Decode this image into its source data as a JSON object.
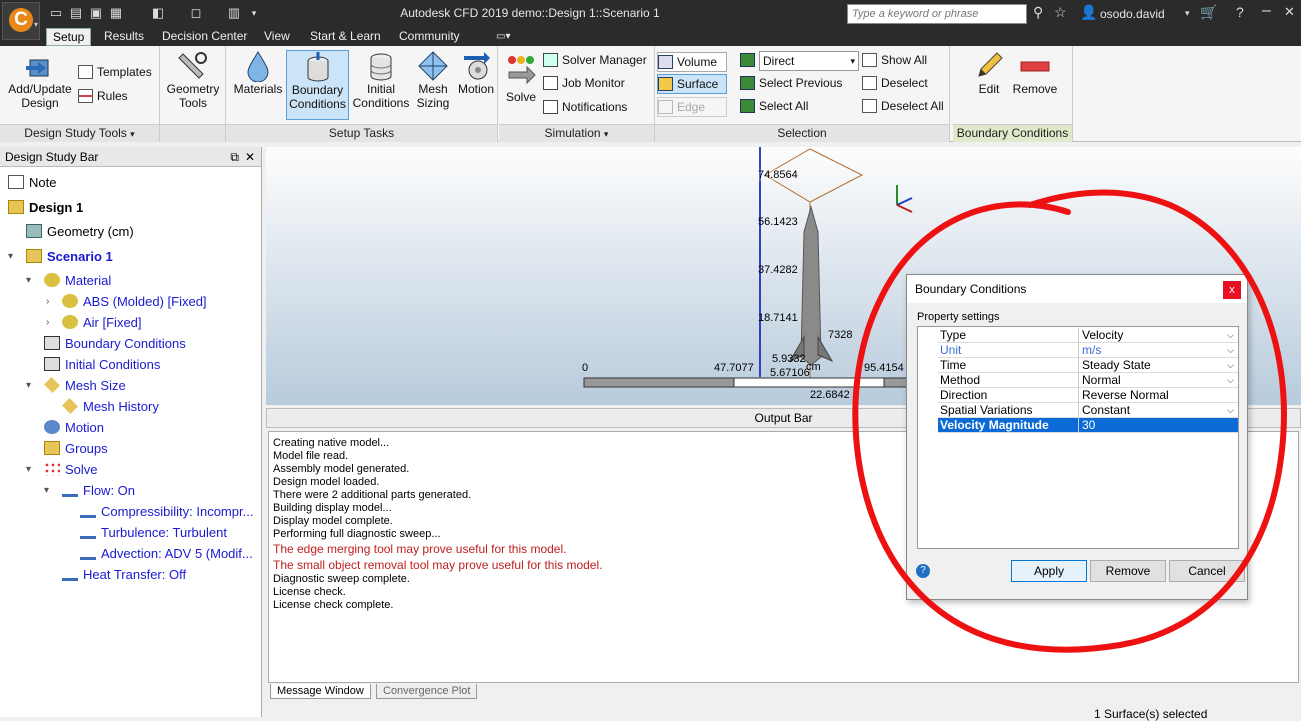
{
  "app": {
    "title": "Autodesk CFD 2019   demo::Design 1::Scenario 1",
    "search_placeholder": "Type a keyword or phrase",
    "username": "osodo.david",
    "logo_letter": "C"
  },
  "ribbon_tabs": [
    "Setup",
    "Results",
    "Decision Center",
    "View",
    "Start & Learn",
    "Community"
  ],
  "ribbon": {
    "design_study_tools": {
      "label": "Design Study Tools",
      "add_update_1": "Add/Update",
      "add_update_2": "Design",
      "templates": "Templates",
      "rules": "Rules"
    },
    "geometry_tools": {
      "line1": "Geometry",
      "line2": "Tools"
    },
    "setup_tasks": {
      "label": "Setup Tasks",
      "materials": "Materials",
      "bc_1": "Boundary",
      "bc_2": "Conditions",
      "ic_1": "Initial",
      "ic_2": "Conditions",
      "mesh_1": "Mesh",
      "mesh_2": "Sizing",
      "motion": "Motion"
    },
    "simulation": {
      "label": "Simulation",
      "solve": "Solve",
      "solver_manager": "Solver Manager",
      "job_monitor": "Job Monitor",
      "notifications": "Notifications"
    },
    "selection": {
      "label": "Selection",
      "volume": "Volume",
      "surface": "Surface",
      "edge": "Edge",
      "direct": "Direct",
      "select_previous": "Select Previous",
      "select_all": "Select All",
      "show_all": "Show All",
      "deselect": "Deselect",
      "deselect_all": "Deselect All"
    },
    "bc_context": {
      "label": "Boundary Conditions",
      "edit": "Edit",
      "remove": "Remove"
    }
  },
  "design_study_bar": {
    "title": "Design Study Bar",
    "items": {
      "note": "Note",
      "design": "Design 1",
      "geometry": "Geometry (cm)",
      "scenario": "Scenario 1",
      "material": "Material",
      "abs": "ABS (Molded) [Fixed]",
      "air": "Air [Fixed]",
      "bc": "Boundary Conditions",
      "ic": "Initial Conditions",
      "mesh_size": "Mesh Size",
      "mesh_history": "Mesh History",
      "motion": "Motion",
      "groups": "Groups",
      "solve": "Solve",
      "flow": "Flow: On",
      "compressibility": "Compressibility: Incompr...",
      "turbulence": "Turbulence: Turbulent",
      "advection": "Advection: ADV 5 (Modif...",
      "heat_transfer": "Heat Transfer: Off"
    }
  },
  "viewport": {
    "vertical_ticks": [
      "74.8564",
      "56.1423",
      "37.4282",
      "18.7141"
    ],
    "ruler_ticks": [
      "0",
      "47.7077",
      "95.4154"
    ],
    "extra_labels": [
      "7328",
      "5.9332",
      "5.67106",
      "22.6842",
      "cm"
    ]
  },
  "output_bar": {
    "title": "Output Bar",
    "messages": [
      {
        "text": "Creating native model...",
        "warn": false
      },
      {
        "text": "Model file read.",
        "warn": false
      },
      {
        "text": "Assembly model generated.",
        "warn": false
      },
      {
        "text": "Design model loaded.",
        "warn": false
      },
      {
        "text": "There were 2 additional parts generated.",
        "warn": false
      },
      {
        "text": "Building display model...",
        "warn": false
      },
      {
        "text": "Display model complete.",
        "warn": false
      },
      {
        "text": "Performing full diagnostic sweep...",
        "warn": false
      },
      {
        "text": "The edge merging tool may prove useful for this model.",
        "warn": true
      },
      {
        "text": "The small object removal tool may prove useful for this model.",
        "warn": true
      },
      {
        "text": "Diagnostic sweep complete.",
        "warn": false
      },
      {
        "text": "License check.",
        "warn": false
      },
      {
        "text": "License check complete.",
        "warn": false
      }
    ],
    "tabs": [
      "Message Window",
      "Convergence Plot"
    ]
  },
  "status": "1 Surface(s) selected",
  "dialog": {
    "title": "Boundary Conditions",
    "close": "x",
    "group": "Property settings",
    "rows": [
      {
        "name": "Type",
        "value": "Velocity",
        "dropdown": true
      },
      {
        "name": "Unit",
        "value": "m/s",
        "dropdown": true
      },
      {
        "name": "Time",
        "value": "Steady State",
        "dropdown": true
      },
      {
        "name": "Method",
        "value": "Normal",
        "dropdown": true
      },
      {
        "name": "Direction",
        "value": "Reverse Normal",
        "dropdown": false
      },
      {
        "name": "Spatial Variations",
        "value": "Constant",
        "dropdown": true
      },
      {
        "name": "Velocity Magnitude",
        "value": "30",
        "dropdown": false
      }
    ],
    "apply": "Apply",
    "remove": "Remove",
    "cancel": "Cancel"
  },
  "colors": {
    "accent": "#0b6ad6",
    "annotation": "#ee1111",
    "warning_text": "#c02020",
    "logo": "#e8881a"
  }
}
